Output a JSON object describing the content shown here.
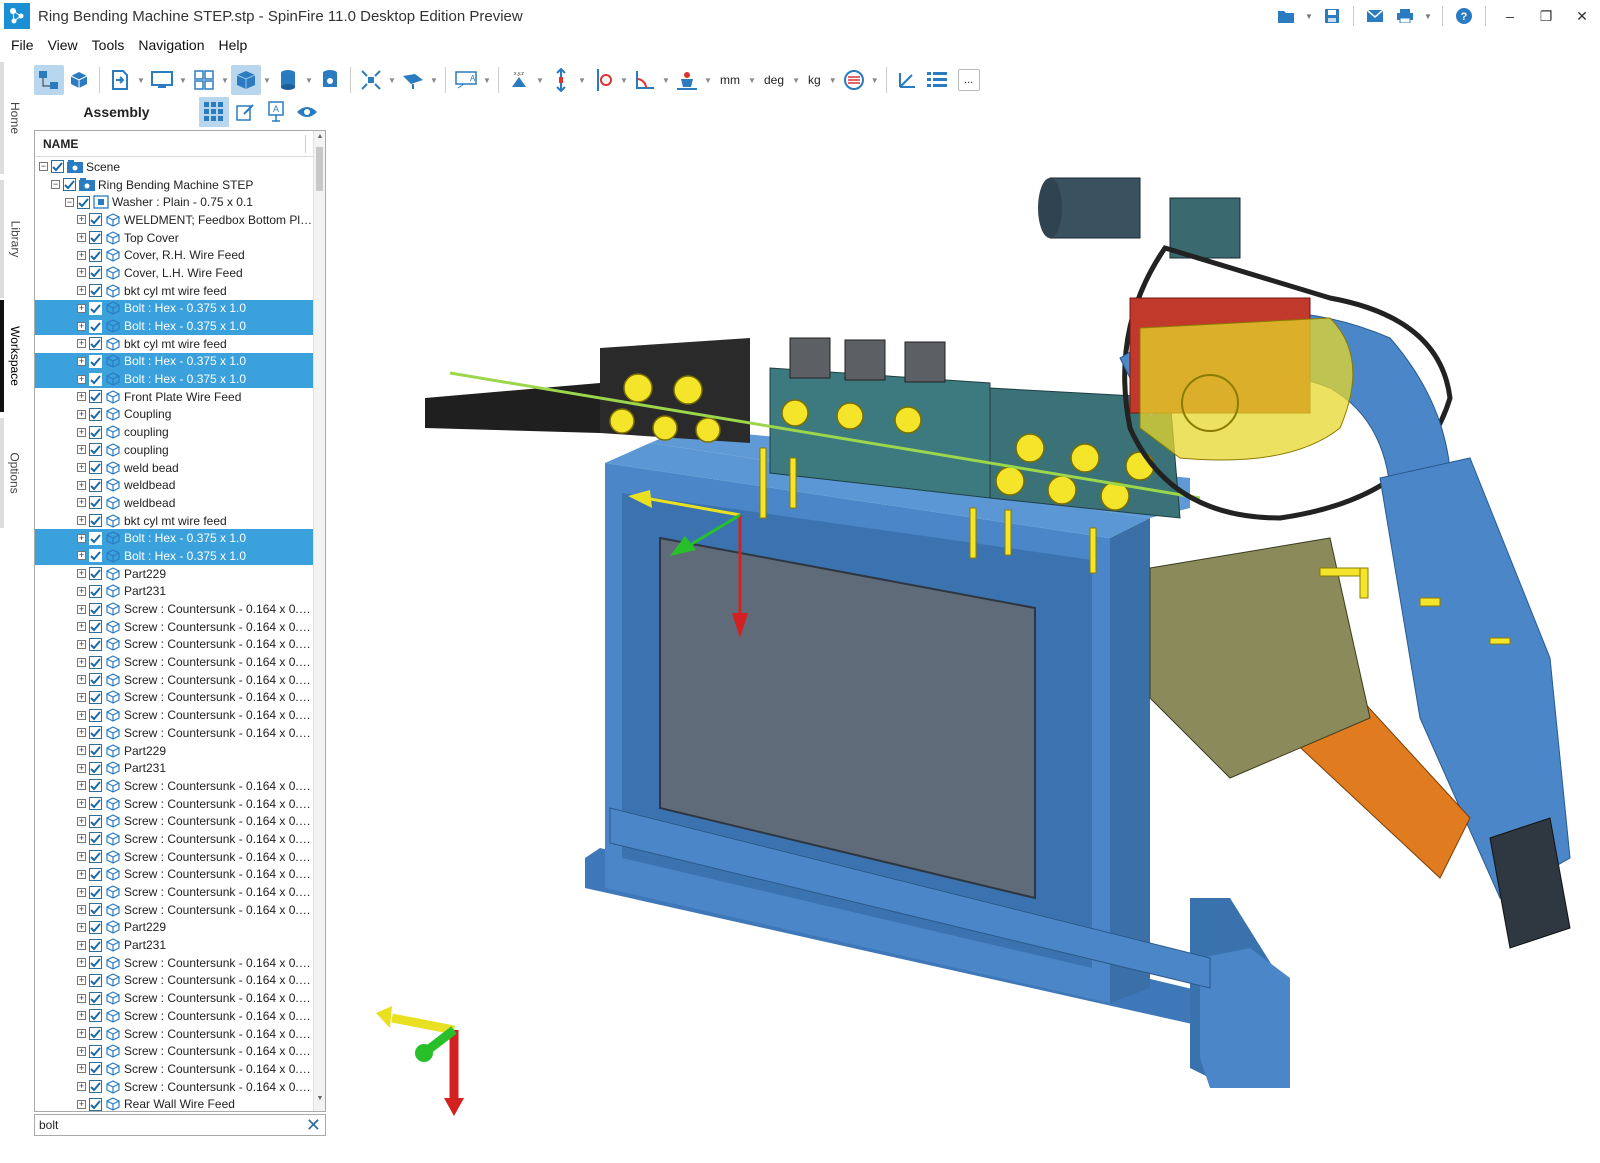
{
  "window": {
    "title": "Ring Bending Machine STEP.stp - SpinFire 11.0 Desktop Edition Preview"
  },
  "menu": [
    "File",
    "View",
    "Tools",
    "Navigation",
    "Help"
  ],
  "units": {
    "length": "mm",
    "angle": "deg",
    "mass": "kg"
  },
  "toolbar": {
    "more_label": "..."
  },
  "side_tabs": [
    "Home",
    "Library",
    "Workspace",
    "Options"
  ],
  "active_side_tab": "Workspace",
  "panel": {
    "title": "Assembly",
    "column_header": "NAME"
  },
  "tree": [
    {
      "label": "Scene",
      "level": 0,
      "kind": "scene",
      "sel": false
    },
    {
      "label": "Ring Bending Machine STEP",
      "level": 1,
      "kind": "assembly",
      "sel": false
    },
    {
      "label": "Washer : Plain - 0.75 x 0.1",
      "level": 2,
      "kind": "subassembly",
      "sel": false
    },
    {
      "label": "WELDMENT; Feedbox Bottom Pla...",
      "level": 3,
      "kind": "part",
      "sel": false
    },
    {
      "label": "Top Cover",
      "level": 3,
      "kind": "part",
      "sel": false
    },
    {
      "label": "Cover, R.H. Wire Feed",
      "level": 3,
      "kind": "part",
      "sel": false
    },
    {
      "label": "Cover, L.H. Wire Feed",
      "level": 3,
      "kind": "part",
      "sel": false
    },
    {
      "label": "bkt cyl mt wire feed",
      "level": 3,
      "kind": "part",
      "sel": false
    },
    {
      "label": "Bolt : Hex - 0.375 x 1.0",
      "level": 3,
      "kind": "part",
      "sel": true
    },
    {
      "label": "Bolt : Hex - 0.375 x 1.0",
      "level": 3,
      "kind": "part",
      "sel": true
    },
    {
      "label": "bkt cyl mt wire feed",
      "level": 3,
      "kind": "part",
      "sel": false
    },
    {
      "label": "Bolt : Hex - 0.375 x 1.0",
      "level": 3,
      "kind": "part",
      "sel": true
    },
    {
      "label": "Bolt : Hex - 0.375 x 1.0",
      "level": 3,
      "kind": "part",
      "sel": true
    },
    {
      "label": "Front Plate Wire Feed",
      "level": 3,
      "kind": "part",
      "sel": false
    },
    {
      "label": "Coupling",
      "level": 3,
      "kind": "part",
      "sel": false
    },
    {
      "label": "coupling",
      "level": 3,
      "kind": "part",
      "sel": false
    },
    {
      "label": "coupling",
      "level": 3,
      "kind": "part",
      "sel": false
    },
    {
      "label": "weld bead",
      "level": 3,
      "kind": "part",
      "sel": false
    },
    {
      "label": "weldbead",
      "level": 3,
      "kind": "part",
      "sel": false
    },
    {
      "label": "weldbead",
      "level": 3,
      "kind": "part",
      "sel": false
    },
    {
      "label": "bkt cyl mt wire feed",
      "level": 3,
      "kind": "part",
      "sel": false
    },
    {
      "label": "Bolt : Hex - 0.375 x 1.0",
      "level": 3,
      "kind": "part",
      "sel": true
    },
    {
      "label": "Bolt : Hex - 0.375 x 1.0",
      "level": 3,
      "kind": "part",
      "sel": true
    },
    {
      "label": "Part229",
      "level": 3,
      "kind": "part",
      "sel": false
    },
    {
      "label": "Part231",
      "level": 3,
      "kind": "part",
      "sel": false
    },
    {
      "label": "Screw : Countersunk - 0.164 x 0.3...",
      "level": 3,
      "kind": "part",
      "sel": false
    },
    {
      "label": "Screw : Countersunk - 0.164 x 0.3...",
      "level": 3,
      "kind": "part",
      "sel": false
    },
    {
      "label": "Screw : Countersunk - 0.164 x 0.3...",
      "level": 3,
      "kind": "part",
      "sel": false
    },
    {
      "label": "Screw : Countersunk - 0.164 x 0.3...",
      "level": 3,
      "kind": "part",
      "sel": false
    },
    {
      "label": "Screw : Countersunk - 0.164 x 0.3...",
      "level": 3,
      "kind": "part",
      "sel": false
    },
    {
      "label": "Screw : Countersunk - 0.164 x 0.3...",
      "level": 3,
      "kind": "part",
      "sel": false
    },
    {
      "label": "Screw : Countersunk - 0.164 x 0.3...",
      "level": 3,
      "kind": "part",
      "sel": false
    },
    {
      "label": "Screw : Countersunk - 0.164 x 0.3...",
      "level": 3,
      "kind": "part",
      "sel": false
    },
    {
      "label": "Part229",
      "level": 3,
      "kind": "part",
      "sel": false
    },
    {
      "label": "Part231",
      "level": 3,
      "kind": "part",
      "sel": false
    },
    {
      "label": "Screw : Countersunk - 0.164 x 0.3...",
      "level": 3,
      "kind": "part",
      "sel": false
    },
    {
      "label": "Screw : Countersunk - 0.164 x 0.3...",
      "level": 3,
      "kind": "part",
      "sel": false
    },
    {
      "label": "Screw : Countersunk - 0.164 x 0.3...",
      "level": 3,
      "kind": "part",
      "sel": false
    },
    {
      "label": "Screw : Countersunk - 0.164 x 0.3...",
      "level": 3,
      "kind": "part",
      "sel": false
    },
    {
      "label": "Screw : Countersunk - 0.164 x 0.3...",
      "level": 3,
      "kind": "part",
      "sel": false
    },
    {
      "label": "Screw : Countersunk - 0.164 x 0.3...",
      "level": 3,
      "kind": "part",
      "sel": false
    },
    {
      "label": "Screw : Countersunk - 0.164 x 0.3...",
      "level": 3,
      "kind": "part",
      "sel": false
    },
    {
      "label": "Screw : Countersunk - 0.164 x 0.3...",
      "level": 3,
      "kind": "part",
      "sel": false
    },
    {
      "label": "Part229",
      "level": 3,
      "kind": "part",
      "sel": false
    },
    {
      "label": "Part231",
      "level": 3,
      "kind": "part",
      "sel": false
    },
    {
      "label": "Screw : Countersunk - 0.164 x 0.3...",
      "level": 3,
      "kind": "part",
      "sel": false
    },
    {
      "label": "Screw : Countersunk - 0.164 x 0.3...",
      "level": 3,
      "kind": "part",
      "sel": false
    },
    {
      "label": "Screw : Countersunk - 0.164 x 0.3...",
      "level": 3,
      "kind": "part",
      "sel": false
    },
    {
      "label": "Screw : Countersunk - 0.164 x 0.3...",
      "level": 3,
      "kind": "part",
      "sel": false
    },
    {
      "label": "Screw : Countersunk - 0.164 x 0.3...",
      "level": 3,
      "kind": "part",
      "sel": false
    },
    {
      "label": "Screw : Countersunk - 0.164 x 0.3...",
      "level": 3,
      "kind": "part",
      "sel": false
    },
    {
      "label": "Screw : Countersunk - 0.164 x 0.3...",
      "level": 3,
      "kind": "part",
      "sel": false
    },
    {
      "label": "Screw : Countersunk - 0.164 x 0.3...",
      "level": 3,
      "kind": "part",
      "sel": false
    },
    {
      "label": "Rear Wall Wire Feed",
      "level": 3,
      "kind": "part",
      "sel": false
    }
  ],
  "search": {
    "value": "bolt"
  },
  "colors": {
    "accent": "#3ba1dc",
    "frame_blue": "#4a86c8",
    "highlight_yellow": "#f5e52a",
    "panel_gray": "#5f6b78"
  }
}
